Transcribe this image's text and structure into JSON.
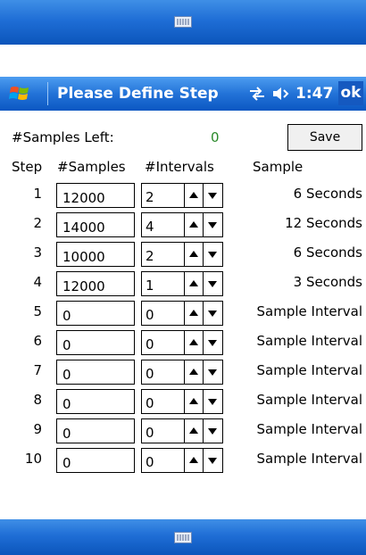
{
  "title_bar": {
    "title": "Please Define Step",
    "clock": "1:47",
    "ok_label": "ok"
  },
  "samples_left": {
    "label": "#Samples Left:",
    "value": "0"
  },
  "save_label": "Save",
  "headers": {
    "step": "Step",
    "samples": "#Samples",
    "intervals": "#Intervals",
    "sample": "Sample"
  },
  "rows": [
    {
      "step": "1",
      "samples": "12000",
      "intervals": "2",
      "sample": "6 Seconds"
    },
    {
      "step": "2",
      "samples": "14000",
      "intervals": "4",
      "sample": "12 Seconds"
    },
    {
      "step": "3",
      "samples": "10000",
      "intervals": "2",
      "sample": "6 Seconds"
    },
    {
      "step": "4",
      "samples": "12000",
      "intervals": "1",
      "sample": "3 Seconds"
    },
    {
      "step": "5",
      "samples": "0",
      "intervals": "0",
      "sample": "Sample Interval"
    },
    {
      "step": "6",
      "samples": "0",
      "intervals": "0",
      "sample": "Sample Interval"
    },
    {
      "step": "7",
      "samples": "0",
      "intervals": "0",
      "sample": "Sample Interval"
    },
    {
      "step": "8",
      "samples": "0",
      "intervals": "0",
      "sample": "Sample Interval"
    },
    {
      "step": "9",
      "samples": "0",
      "intervals": "0",
      "sample": "Sample Interval"
    },
    {
      "step": "10",
      "samples": "0",
      "intervals": "0",
      "sample": "Sample Interval"
    }
  ],
  "icons": {
    "start": "windows-flag-icon",
    "connectivity": "connectivity-icon",
    "volume": "speaker-icon",
    "keyboard": "keyboard-icon"
  },
  "colors": {
    "title_bar": "#2373d8",
    "samples_left_value": "#2b8a2b"
  }
}
